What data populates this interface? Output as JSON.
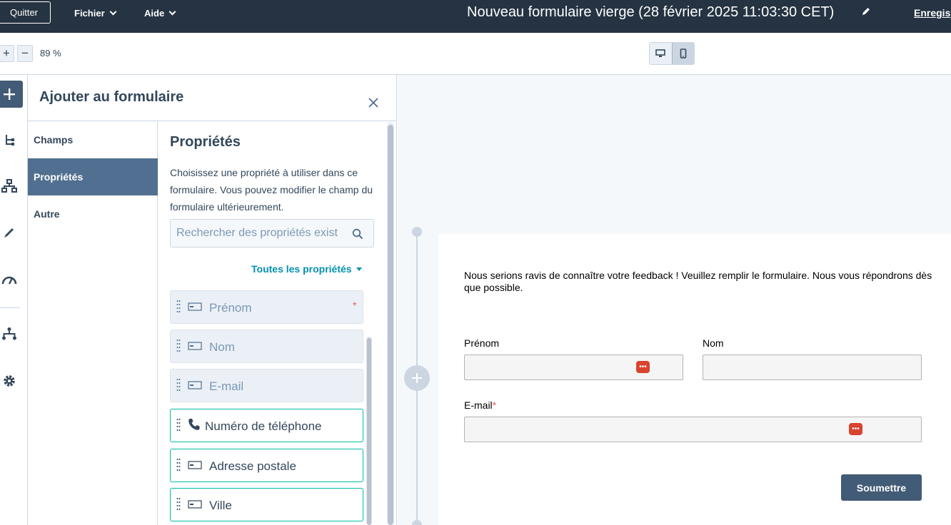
{
  "topbar": {
    "quit_label": "Quitter",
    "menus": [
      {
        "label": "Fichier"
      },
      {
        "label": "Aide"
      }
    ],
    "doc_title": "Nouveau formulaire vierge (28 février 2025 11:03:30 CET)",
    "save_label": "Enregis"
  },
  "toolbar": {
    "zoom_in": "+",
    "zoom_out": "−",
    "zoom_level": "89 %"
  },
  "panel": {
    "title": "Ajouter au formulaire",
    "categories": [
      {
        "label": "Champs"
      },
      {
        "label": "Propriétés"
      },
      {
        "label": "Autre"
      }
    ],
    "properties": {
      "title": "Propriétés",
      "description": "Choisissez une propriété à utiliser dans ce formulaire. Vous pouvez modifier le champ du formulaire ultérieurement.",
      "search_placeholder": "Rechercher des propriétés exist",
      "filter_label": "Toutes les propriétés",
      "items": [
        {
          "label": "Prénom",
          "required_mark": "*",
          "icon": "text-field-icon"
        },
        {
          "label": "Nom",
          "icon": "text-field-icon"
        },
        {
          "label": "E-mail",
          "icon": "text-field-icon"
        },
        {
          "label": "Numéro de téléphone",
          "icon": "phone-icon"
        },
        {
          "label": "Adresse postale",
          "icon": "text-field-icon"
        },
        {
          "label": "Ville",
          "icon": "text-field-icon"
        }
      ]
    }
  },
  "form": {
    "intro": "Nous serions ravis de connaître votre feedback ! Veuillez remplir le formulaire. Nous vous répondrons dès que possible.",
    "fields": {
      "first_name": "Prénom",
      "last_name": "Nom",
      "email": "E-mail",
      "email_required": "*"
    },
    "submit_label": "Soumettre",
    "password_icon_glyph": "•••"
  },
  "colors": {
    "topbar": "#253342",
    "active_category": "#516f90",
    "accent_teal": "#00bda5",
    "link": "#0091ae",
    "submit": "#425b76",
    "required": "#f2545b"
  }
}
